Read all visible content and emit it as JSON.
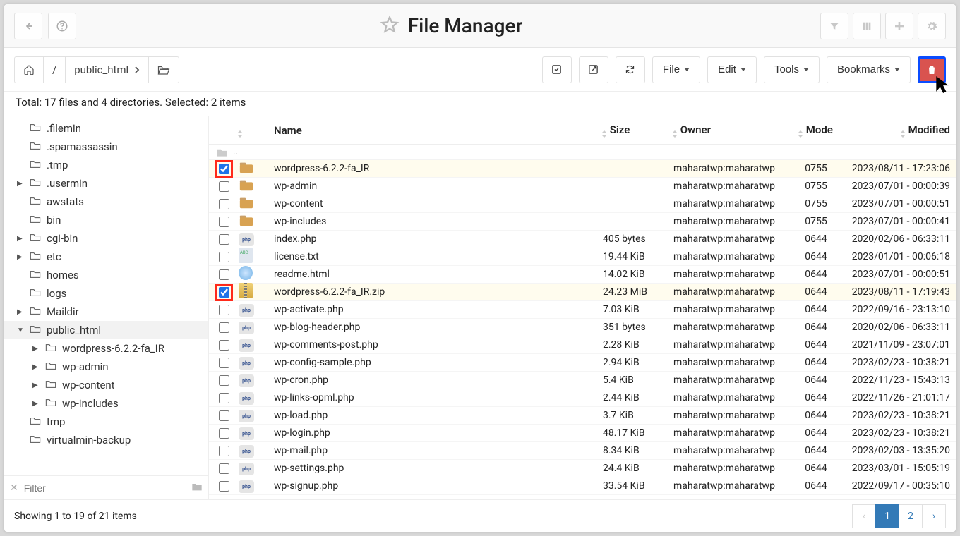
{
  "header": {
    "title": "File Manager"
  },
  "breadcrumb": [
    "public_html"
  ],
  "toolbar": {
    "file": "File",
    "edit": "Edit",
    "tools": "Tools",
    "bookmarks": "Bookmarks"
  },
  "status": "Total: 17 files and 4 directories. Selected: 2 items",
  "sidebar": {
    "filter_placeholder": "Filter",
    "tree": [
      {
        "label": ".filemin",
        "level": 0,
        "expandable": false
      },
      {
        "label": ".spamassassin",
        "level": 0,
        "expandable": false
      },
      {
        "label": ".tmp",
        "level": 0,
        "expandable": false
      },
      {
        "label": ".usermin",
        "level": 0,
        "expandable": true
      },
      {
        "label": "awstats",
        "level": 0,
        "expandable": false
      },
      {
        "label": "bin",
        "level": 0,
        "expandable": false
      },
      {
        "label": "cgi-bin",
        "level": 0,
        "expandable": true
      },
      {
        "label": "etc",
        "level": 0,
        "expandable": true
      },
      {
        "label": "homes",
        "level": 0,
        "expandable": false
      },
      {
        "label": "logs",
        "level": 0,
        "expandable": false
      },
      {
        "label": "Maildir",
        "level": 0,
        "expandable": true
      },
      {
        "label": "public_html",
        "level": 0,
        "expandable": true,
        "expanded": true,
        "active": true
      },
      {
        "label": "wordpress-6.2.2-fa_IR",
        "level": 1,
        "expandable": true
      },
      {
        "label": "wp-admin",
        "level": 1,
        "expandable": true
      },
      {
        "label": "wp-content",
        "level": 1,
        "expandable": true
      },
      {
        "label": "wp-includes",
        "level": 1,
        "expandable": true
      },
      {
        "label": "tmp",
        "level": 0,
        "expandable": false
      },
      {
        "label": "virtualmin-backup",
        "level": 0,
        "expandable": false
      }
    ]
  },
  "columns": {
    "name": "Name",
    "size": "Size",
    "owner": "Owner",
    "mode": "Mode",
    "modified": "Modified"
  },
  "listing": {
    "parent": "..",
    "rows": [
      {
        "checked": true,
        "highlight": true,
        "type": "folder",
        "name": "wordpress-6.2.2-fa_IR",
        "size": "",
        "owner": "maharatwp:maharatwp",
        "mode": "0755",
        "modified": "2023/08/11 - 17:23:06"
      },
      {
        "checked": false,
        "type": "folder",
        "name": "wp-admin",
        "size": "",
        "owner": "maharatwp:maharatwp",
        "mode": "0755",
        "modified": "2023/07/01 - 00:00:39"
      },
      {
        "checked": false,
        "type": "folder",
        "name": "wp-content",
        "size": "",
        "owner": "maharatwp:maharatwp",
        "mode": "0755",
        "modified": "2023/07/01 - 00:00:51"
      },
      {
        "checked": false,
        "type": "folder",
        "name": "wp-includes",
        "size": "",
        "owner": "maharatwp:maharatwp",
        "mode": "0755",
        "modified": "2023/07/01 - 00:00:41"
      },
      {
        "checked": false,
        "type": "php",
        "name": "index.php",
        "size": "405 bytes",
        "owner": "maharatwp:maharatwp",
        "mode": "0644",
        "modified": "2020/02/06 - 06:33:11"
      },
      {
        "checked": false,
        "type": "txt",
        "name": "license.txt",
        "size": "19.44 KiB",
        "owner": "maharatwp:maharatwp",
        "mode": "0644",
        "modified": "2023/01/01 - 00:06:18"
      },
      {
        "checked": false,
        "type": "html",
        "name": "readme.html",
        "size": "14.02 KiB",
        "owner": "maharatwp:maharatwp",
        "mode": "0644",
        "modified": "2023/07/01 - 00:00:51"
      },
      {
        "checked": true,
        "highlight": true,
        "type": "zip",
        "name": "wordpress-6.2.2-fa_IR.zip",
        "size": "24.23 MiB",
        "owner": "maharatwp:maharatwp",
        "mode": "0644",
        "modified": "2023/08/11 - 17:19:43"
      },
      {
        "checked": false,
        "type": "php",
        "name": "wp-activate.php",
        "size": "7.03 KiB",
        "owner": "maharatwp:maharatwp",
        "mode": "0644",
        "modified": "2022/09/16 - 23:13:10"
      },
      {
        "checked": false,
        "type": "php",
        "name": "wp-blog-header.php",
        "size": "351 bytes",
        "owner": "maharatwp:maharatwp",
        "mode": "0644",
        "modified": "2020/02/06 - 06:33:11"
      },
      {
        "checked": false,
        "type": "php",
        "name": "wp-comments-post.php",
        "size": "2.28 KiB",
        "owner": "maharatwp:maharatwp",
        "mode": "0644",
        "modified": "2021/11/09 - 23:07:01"
      },
      {
        "checked": false,
        "type": "php",
        "name": "wp-config-sample.php",
        "size": "2.94 KiB",
        "owner": "maharatwp:maharatwp",
        "mode": "0644",
        "modified": "2023/02/23 - 10:38:21"
      },
      {
        "checked": false,
        "type": "php",
        "name": "wp-cron.php",
        "size": "5.4 KiB",
        "owner": "maharatwp:maharatwp",
        "mode": "0644",
        "modified": "2022/11/23 - 15:43:13"
      },
      {
        "checked": false,
        "type": "php",
        "name": "wp-links-opml.php",
        "size": "2.44 KiB",
        "owner": "maharatwp:maharatwp",
        "mode": "0644",
        "modified": "2022/11/26 - 21:01:17"
      },
      {
        "checked": false,
        "type": "php",
        "name": "wp-load.php",
        "size": "3.7 KiB",
        "owner": "maharatwp:maharatwp",
        "mode": "0644",
        "modified": "2023/02/23 - 10:38:21"
      },
      {
        "checked": false,
        "type": "php",
        "name": "wp-login.php",
        "size": "48.17 KiB",
        "owner": "maharatwp:maharatwp",
        "mode": "0644",
        "modified": "2023/02/23 - 10:38:21"
      },
      {
        "checked": false,
        "type": "php",
        "name": "wp-mail.php",
        "size": "8.34 KiB",
        "owner": "maharatwp:maharatwp",
        "mode": "0644",
        "modified": "2023/02/03 - 13:35:20"
      },
      {
        "checked": false,
        "type": "php",
        "name": "wp-settings.php",
        "size": "24.4 KiB",
        "owner": "maharatwp:maharatwp",
        "mode": "0644",
        "modified": "2023/03/01 - 15:05:19"
      },
      {
        "checked": false,
        "type": "php",
        "name": "wp-signup.php",
        "size": "33.54 KiB",
        "owner": "maharatwp:maharatwp",
        "mode": "0644",
        "modified": "2022/09/17 - 00:35:10"
      }
    ]
  },
  "footer": {
    "showing": "Showing 1 to 19 of 21 items",
    "pages": [
      "1",
      "2"
    ]
  }
}
